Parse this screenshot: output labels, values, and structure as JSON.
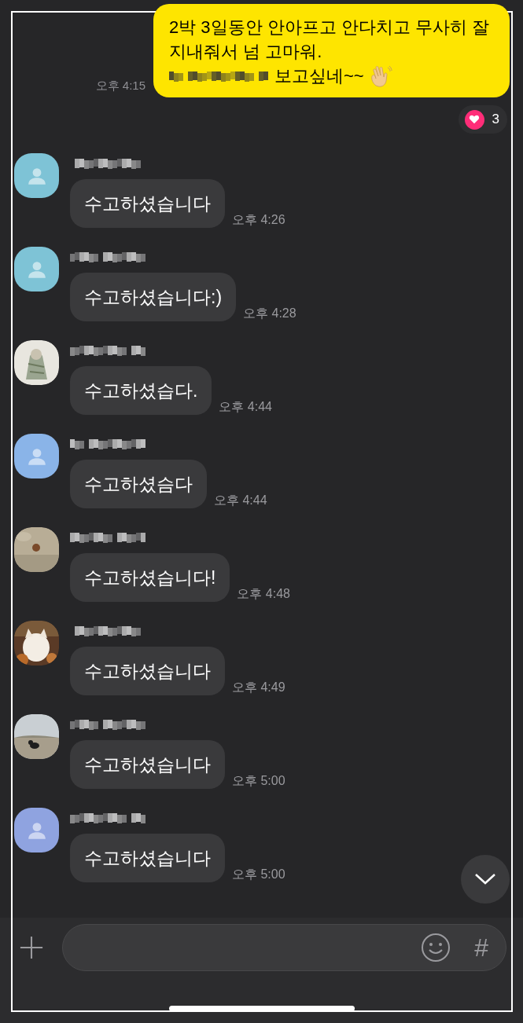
{
  "my_message": {
    "lines": [
      "2박 3일동안 안아프고 안다치고 무사히 잘",
      "지내줘서 넘 고마워."
    ],
    "last_line_visible": "보고싶네~~",
    "time": "오후 4:15",
    "reaction": {
      "count": "3"
    }
  },
  "messages": [
    {
      "avatar": {
        "kind": "default",
        "color": "#7ec3d6"
      },
      "text": "수고하셨습니다",
      "time": "오후 4:26"
    },
    {
      "avatar": {
        "kind": "default",
        "color": "#7ec3d6"
      },
      "text": "수고하셨습니다:)",
      "time": "오후 4:28"
    },
    {
      "text": "수고하셨습다.",
      "time": "오후 4:44"
    },
    {
      "avatar": {
        "kind": "default",
        "color": "#8ab4e8"
      },
      "text": "수고하셨슴다",
      "time": "오후 4:44"
    },
    {
      "text": "수고하셨습니다!",
      "time": "오후 4:48"
    },
    {
      "text": "수고하셨습니다",
      "time": "오후 4:49"
    },
    {
      "text": "수고하셨습니다",
      "time": "오후 5:00"
    },
    {
      "avatar": {
        "kind": "default",
        "color": "#8fa3e0"
      },
      "text": "수고하셨습니다",
      "time": "오후 5:00"
    }
  ],
  "composer": {
    "hashtag": "#"
  }
}
